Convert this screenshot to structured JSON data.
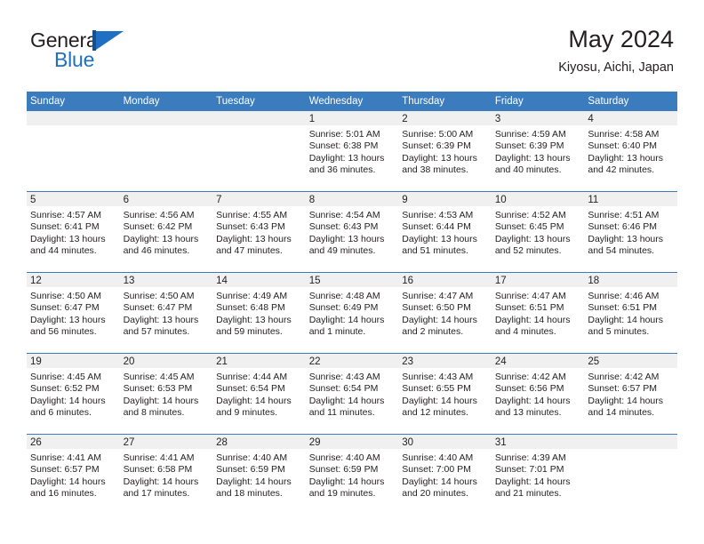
{
  "logo": {
    "word_top": "General",
    "word_bottom": "Blue",
    "mark": "triangle-flag-icon"
  },
  "header": {
    "title": "May 2024",
    "subtitle": "Kiyosu, Aichi, Japan"
  },
  "colors": {
    "header_blue": "#3b7cbe",
    "logo_blue": "#1f6fc4",
    "daynum_band": "#f0f0f0",
    "text": "#231f20"
  },
  "weekday_headers": [
    "Sunday",
    "Monday",
    "Tuesday",
    "Wednesday",
    "Thursday",
    "Friday",
    "Saturday"
  ],
  "labels": {
    "sunrise": "Sunrise:",
    "sunset": "Sunset:",
    "daylight": "Daylight:"
  },
  "weeks": [
    [
      {
        "day": "",
        "empty": true
      },
      {
        "day": "",
        "empty": true
      },
      {
        "day": "",
        "empty": true
      },
      {
        "day": "1",
        "sunrise": "Sunrise: 5:01 AM",
        "sunset": "Sunset: 6:38 PM",
        "daylight1": "Daylight: 13 hours",
        "daylight2": "and 36 minutes."
      },
      {
        "day": "2",
        "sunrise": "Sunrise: 5:00 AM",
        "sunset": "Sunset: 6:39 PM",
        "daylight1": "Daylight: 13 hours",
        "daylight2": "and 38 minutes."
      },
      {
        "day": "3",
        "sunrise": "Sunrise: 4:59 AM",
        "sunset": "Sunset: 6:39 PM",
        "daylight1": "Daylight: 13 hours",
        "daylight2": "and 40 minutes."
      },
      {
        "day": "4",
        "sunrise": "Sunrise: 4:58 AM",
        "sunset": "Sunset: 6:40 PM",
        "daylight1": "Daylight: 13 hours",
        "daylight2": "and 42 minutes."
      }
    ],
    [
      {
        "day": "5",
        "sunrise": "Sunrise: 4:57 AM",
        "sunset": "Sunset: 6:41 PM",
        "daylight1": "Daylight: 13 hours",
        "daylight2": "and 44 minutes."
      },
      {
        "day": "6",
        "sunrise": "Sunrise: 4:56 AM",
        "sunset": "Sunset: 6:42 PM",
        "daylight1": "Daylight: 13 hours",
        "daylight2": "and 46 minutes."
      },
      {
        "day": "7",
        "sunrise": "Sunrise: 4:55 AM",
        "sunset": "Sunset: 6:43 PM",
        "daylight1": "Daylight: 13 hours",
        "daylight2": "and 47 minutes."
      },
      {
        "day": "8",
        "sunrise": "Sunrise: 4:54 AM",
        "sunset": "Sunset: 6:43 PM",
        "daylight1": "Daylight: 13 hours",
        "daylight2": "and 49 minutes."
      },
      {
        "day": "9",
        "sunrise": "Sunrise: 4:53 AM",
        "sunset": "Sunset: 6:44 PM",
        "daylight1": "Daylight: 13 hours",
        "daylight2": "and 51 minutes."
      },
      {
        "day": "10",
        "sunrise": "Sunrise: 4:52 AM",
        "sunset": "Sunset: 6:45 PM",
        "daylight1": "Daylight: 13 hours",
        "daylight2": "and 52 minutes."
      },
      {
        "day": "11",
        "sunrise": "Sunrise: 4:51 AM",
        "sunset": "Sunset: 6:46 PM",
        "daylight1": "Daylight: 13 hours",
        "daylight2": "and 54 minutes."
      }
    ],
    [
      {
        "day": "12",
        "sunrise": "Sunrise: 4:50 AM",
        "sunset": "Sunset: 6:47 PM",
        "daylight1": "Daylight: 13 hours",
        "daylight2": "and 56 minutes."
      },
      {
        "day": "13",
        "sunrise": "Sunrise: 4:50 AM",
        "sunset": "Sunset: 6:47 PM",
        "daylight1": "Daylight: 13 hours",
        "daylight2": "and 57 minutes."
      },
      {
        "day": "14",
        "sunrise": "Sunrise: 4:49 AM",
        "sunset": "Sunset: 6:48 PM",
        "daylight1": "Daylight: 13 hours",
        "daylight2": "and 59 minutes."
      },
      {
        "day": "15",
        "sunrise": "Sunrise: 4:48 AM",
        "sunset": "Sunset: 6:49 PM",
        "daylight1": "Daylight: 14 hours",
        "daylight2": "and 1 minute."
      },
      {
        "day": "16",
        "sunrise": "Sunrise: 4:47 AM",
        "sunset": "Sunset: 6:50 PM",
        "daylight1": "Daylight: 14 hours",
        "daylight2": "and 2 minutes."
      },
      {
        "day": "17",
        "sunrise": "Sunrise: 4:47 AM",
        "sunset": "Sunset: 6:51 PM",
        "daylight1": "Daylight: 14 hours",
        "daylight2": "and 4 minutes."
      },
      {
        "day": "18",
        "sunrise": "Sunrise: 4:46 AM",
        "sunset": "Sunset: 6:51 PM",
        "daylight1": "Daylight: 14 hours",
        "daylight2": "and 5 minutes."
      }
    ],
    [
      {
        "day": "19",
        "sunrise": "Sunrise: 4:45 AM",
        "sunset": "Sunset: 6:52 PM",
        "daylight1": "Daylight: 14 hours",
        "daylight2": "and 6 minutes."
      },
      {
        "day": "20",
        "sunrise": "Sunrise: 4:45 AM",
        "sunset": "Sunset: 6:53 PM",
        "daylight1": "Daylight: 14 hours",
        "daylight2": "and 8 minutes."
      },
      {
        "day": "21",
        "sunrise": "Sunrise: 4:44 AM",
        "sunset": "Sunset: 6:54 PM",
        "daylight1": "Daylight: 14 hours",
        "daylight2": "and 9 minutes."
      },
      {
        "day": "22",
        "sunrise": "Sunrise: 4:43 AM",
        "sunset": "Sunset: 6:54 PM",
        "daylight1": "Daylight: 14 hours",
        "daylight2": "and 11 minutes."
      },
      {
        "day": "23",
        "sunrise": "Sunrise: 4:43 AM",
        "sunset": "Sunset: 6:55 PM",
        "daylight1": "Daylight: 14 hours",
        "daylight2": "and 12 minutes."
      },
      {
        "day": "24",
        "sunrise": "Sunrise: 4:42 AM",
        "sunset": "Sunset: 6:56 PM",
        "daylight1": "Daylight: 14 hours",
        "daylight2": "and 13 minutes."
      },
      {
        "day": "25",
        "sunrise": "Sunrise: 4:42 AM",
        "sunset": "Sunset: 6:57 PM",
        "daylight1": "Daylight: 14 hours",
        "daylight2": "and 14 minutes."
      }
    ],
    [
      {
        "day": "26",
        "sunrise": "Sunrise: 4:41 AM",
        "sunset": "Sunset: 6:57 PM",
        "daylight1": "Daylight: 14 hours",
        "daylight2": "and 16 minutes."
      },
      {
        "day": "27",
        "sunrise": "Sunrise: 4:41 AM",
        "sunset": "Sunset: 6:58 PM",
        "daylight1": "Daylight: 14 hours",
        "daylight2": "and 17 minutes."
      },
      {
        "day": "28",
        "sunrise": "Sunrise: 4:40 AM",
        "sunset": "Sunset: 6:59 PM",
        "daylight1": "Daylight: 14 hours",
        "daylight2": "and 18 minutes."
      },
      {
        "day": "29",
        "sunrise": "Sunrise: 4:40 AM",
        "sunset": "Sunset: 6:59 PM",
        "daylight1": "Daylight: 14 hours",
        "daylight2": "and 19 minutes."
      },
      {
        "day": "30",
        "sunrise": "Sunrise: 4:40 AM",
        "sunset": "Sunset: 7:00 PM",
        "daylight1": "Daylight: 14 hours",
        "daylight2": "and 20 minutes."
      },
      {
        "day": "31",
        "sunrise": "Sunrise: 4:39 AM",
        "sunset": "Sunset: 7:01 PM",
        "daylight1": "Daylight: 14 hours",
        "daylight2": "and 21 minutes."
      },
      {
        "day": "",
        "empty": true
      }
    ]
  ]
}
